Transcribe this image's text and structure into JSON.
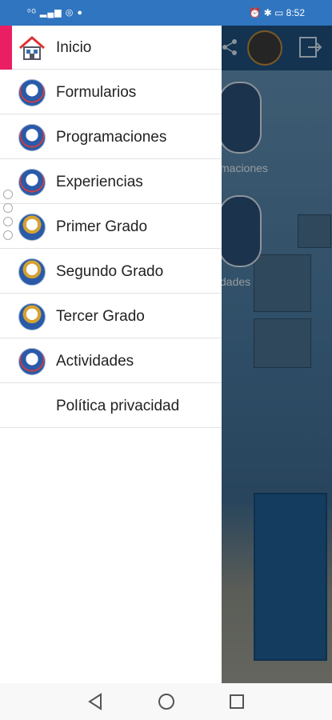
{
  "statusbar": {
    "left_icons": "△█○●",
    "time": "8:52"
  },
  "menu": {
    "items": [
      {
        "label": "Inicio",
        "icon": "home-icon",
        "active": true
      },
      {
        "label": "Formularios",
        "icon": "school-logo-icon"
      },
      {
        "label": "Programaciones",
        "icon": "school-logo-icon"
      },
      {
        "label": "Experiencias",
        "icon": "school-logo-icon"
      },
      {
        "label": "Primer Grado",
        "icon": "grade-logo-icon"
      },
      {
        "label": "Segundo Grado",
        "icon": "grade-logo-icon"
      },
      {
        "label": "Tercer Grado",
        "icon": "grade-logo-icon"
      },
      {
        "label": "Actividades",
        "icon": "school-logo-icon"
      },
      {
        "label": "Política privacidad",
        "icon": ""
      }
    ]
  },
  "background": {
    "tile_labels": [
      "maciones",
      "dades"
    ]
  },
  "colors": {
    "statusbar": "#2f75bf",
    "accent": "#e91e63",
    "appbar": "#1e4f7c"
  }
}
